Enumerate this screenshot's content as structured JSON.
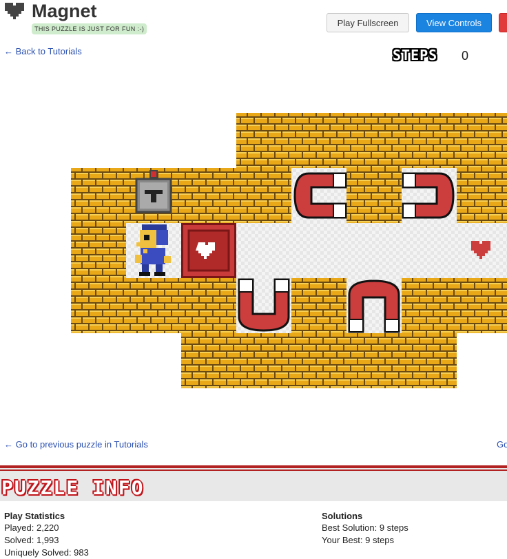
{
  "header": {
    "title": "Magnet",
    "badge": "THIS PUZZLE IS JUST FOR FUN :-)",
    "play_fullscreen": "Play Fullscreen",
    "view_controls": "View Controls"
  },
  "nav": {
    "back": "← Back to Tutorials",
    "prev": "← Go to previous puzzle in Tutorials",
    "next": "Go"
  },
  "steps": {
    "label": "STEPS",
    "value": "0"
  },
  "info": {
    "title": "PUZZLE INFO",
    "play_stats": {
      "heading": "Play Statistics",
      "played": "Played: 2,220",
      "solved": "Solved: 1,993",
      "uniquely": "Uniquely Solved: 983"
    },
    "solutions": {
      "heading": "Solutions",
      "best": "Best Solution: 9 steps",
      "yours": "Your Best: 9 steps"
    }
  },
  "colors": {
    "brick": "#e8a818",
    "mortar": "#6b4a12",
    "magnet_red": "#cc3d3d",
    "accent_blue": "#1a84e0",
    "heart_dark": "#444444"
  }
}
